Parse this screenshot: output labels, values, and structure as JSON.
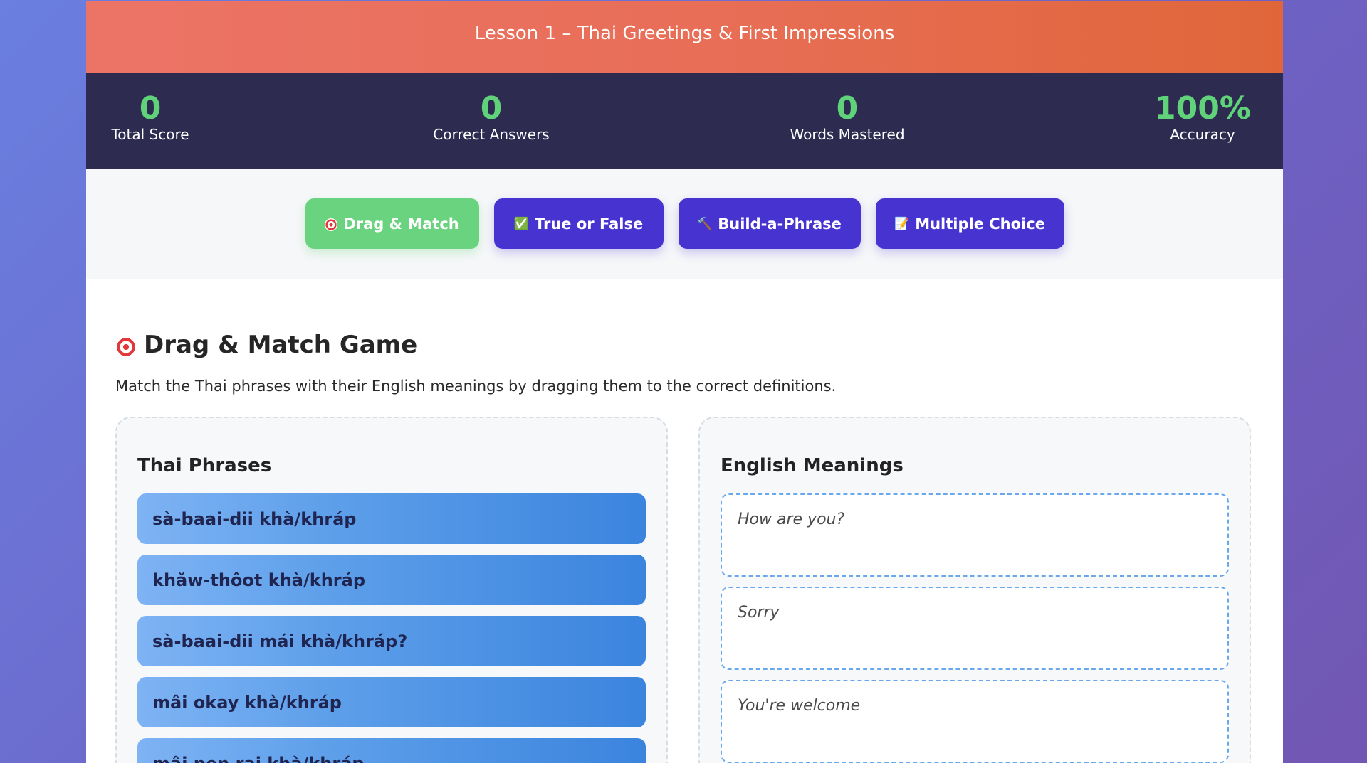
{
  "header": {
    "title": "Lesson 1 – Thai Greetings & First Impressions"
  },
  "stats": [
    {
      "value": "0",
      "label": "Total Score"
    },
    {
      "value": "0",
      "label": "Correct Answers"
    },
    {
      "value": "0",
      "label": "Words Mastered"
    },
    {
      "value": "100%",
      "label": "Accuracy"
    }
  ],
  "nav": {
    "drag_match": {
      "icon": "target-icon",
      "label": "Drag & Match"
    },
    "true_false": {
      "icon": "check-box-icon",
      "emoji": "✅",
      "label": "True or False"
    },
    "build_phrase": {
      "icon": "hammer-icon",
      "emoji": "🔨",
      "label": "Build-a-Phrase"
    },
    "multiple_choice": {
      "icon": "memo-icon",
      "emoji": "📝",
      "label": "Multiple Choice"
    }
  },
  "game": {
    "title": "Drag & Match Game",
    "description": "Match the Thai phrases with their English meanings by dragging them to the correct definitions.",
    "thai_column_title": "Thai Phrases",
    "english_column_title": "English Meanings",
    "phrases": [
      "sà-baai-dii khà/khráp",
      "khǎw-thôot khà/khráp",
      "sà-baai-dii mái khà/khráp?",
      "mâi okay khà/khráp",
      "mâi pen rai khà/khráp"
    ],
    "meanings": [
      "How are you?",
      "Sorry",
      "You're welcome"
    ]
  },
  "colors": {
    "accent_green": "#6ad37f",
    "nav_purple": "#4633d0",
    "stats_bg": "#2d2b4f",
    "stat_value": "#5fd27a"
  }
}
